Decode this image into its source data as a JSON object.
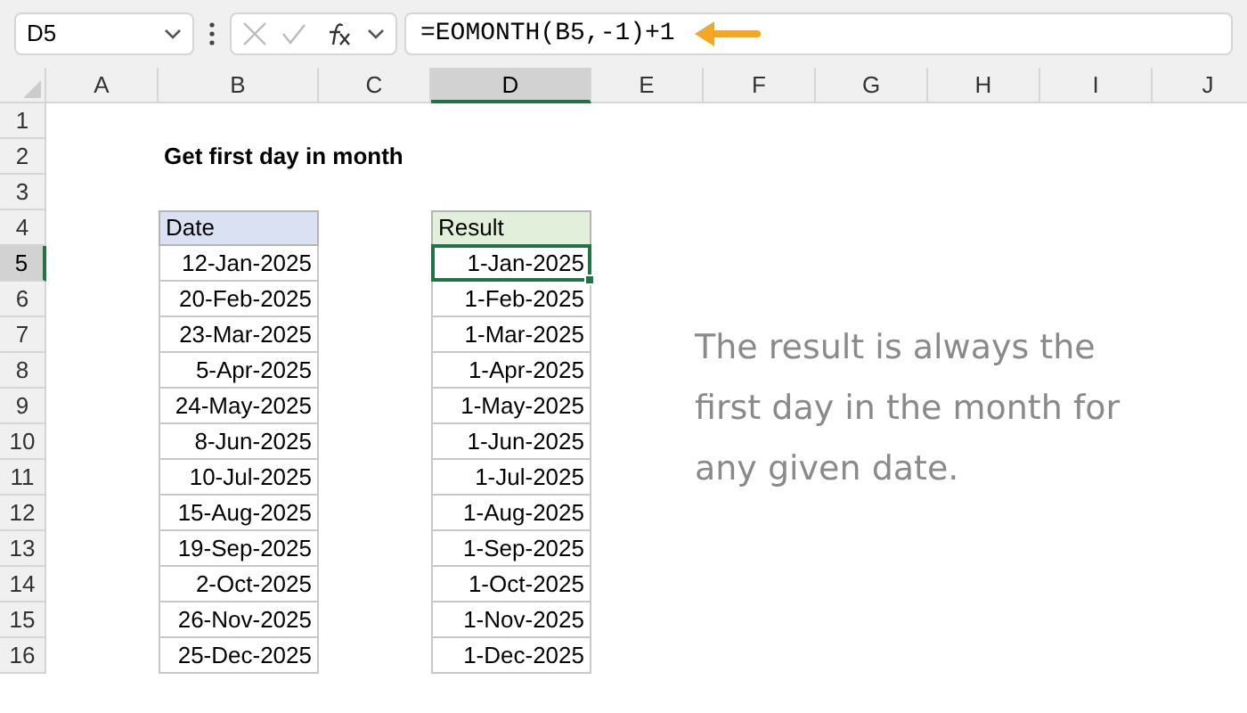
{
  "name_box": "D5",
  "formula": "=EOMONTH(B5,-1)+1",
  "columns": [
    {
      "label": "A",
      "selected": false
    },
    {
      "label": "B",
      "selected": false
    },
    {
      "label": "C",
      "selected": false
    },
    {
      "label": "D",
      "selected": true
    },
    {
      "label": "E",
      "selected": false
    },
    {
      "label": "F",
      "selected": false
    },
    {
      "label": "G",
      "selected": false
    },
    {
      "label": "H",
      "selected": false
    },
    {
      "label": "I",
      "selected": false
    },
    {
      "label": "J",
      "selected": false
    }
  ],
  "rows": [
    {
      "label": "1",
      "selected": false
    },
    {
      "label": "2",
      "selected": false
    },
    {
      "label": "3",
      "selected": false
    },
    {
      "label": "4",
      "selected": false
    },
    {
      "label": "5",
      "selected": true
    },
    {
      "label": "6",
      "selected": false
    },
    {
      "label": "7",
      "selected": false
    },
    {
      "label": "8",
      "selected": false
    },
    {
      "label": "9",
      "selected": false
    },
    {
      "label": "10",
      "selected": false
    },
    {
      "label": "11",
      "selected": false
    },
    {
      "label": "12",
      "selected": false
    },
    {
      "label": "13",
      "selected": false
    },
    {
      "label": "14",
      "selected": false
    },
    {
      "label": "15",
      "selected": false
    },
    {
      "label": "16",
      "selected": false
    }
  ],
  "title": "Get first day in month",
  "date_header": "Date",
  "result_header": "Result",
  "dates": [
    "12-Jan-2025",
    "20-Feb-2025",
    "23-Mar-2025",
    "5-Apr-2025",
    "24-May-2025",
    "8-Jun-2025",
    "10-Jul-2025",
    "15-Aug-2025",
    "19-Sep-2025",
    "2-Oct-2025",
    "26-Nov-2025",
    "25-Dec-2025"
  ],
  "results": [
    {
      "value": "1-Jan-2025",
      "selected": true
    },
    {
      "value": "1-Feb-2025",
      "selected": false
    },
    {
      "value": "1-Mar-2025",
      "selected": false
    },
    {
      "value": "1-Apr-2025",
      "selected": false
    },
    {
      "value": "1-May-2025",
      "selected": false
    },
    {
      "value": "1-Jun-2025",
      "selected": false
    },
    {
      "value": "1-Jul-2025",
      "selected": false
    },
    {
      "value": "1-Aug-2025",
      "selected": false
    },
    {
      "value": "1-Sep-2025",
      "selected": false
    },
    {
      "value": "1-Oct-2025",
      "selected": false
    },
    {
      "value": "1-Nov-2025",
      "selected": false
    },
    {
      "value": "1-Dec-2025",
      "selected": false
    }
  ],
  "note": "The result is always the first day in the month for any given date."
}
